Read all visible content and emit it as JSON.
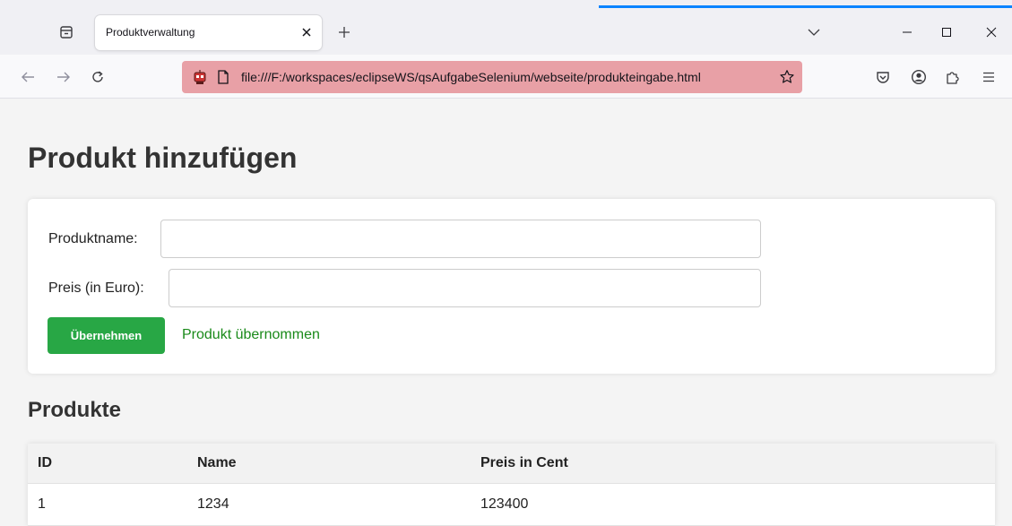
{
  "browser": {
    "tab_title": "Produktverwaltung",
    "url": "file:///F:/workspaces/eclipseWS/qsAufgabeSelenium/webseite/produkteingabe.html"
  },
  "page": {
    "title": "Produkt hinzufügen",
    "form": {
      "name_label": "Produktname:",
      "name_value": "",
      "price_label": "Preis (in Euro):",
      "price_value": "",
      "submit_label": "Übernehmen",
      "success_message": "Produkt übernommen"
    },
    "products_title": "Produkte",
    "table": {
      "headers": [
        "ID",
        "Name",
        "Preis in Cent"
      ],
      "rows": [
        [
          "1",
          "1234",
          "123400"
        ]
      ]
    }
  },
  "colors": {
    "accent_button": "#28a745",
    "success_text": "#1a8a1a",
    "urlbar_highlight": "#e8a0a6"
  }
}
